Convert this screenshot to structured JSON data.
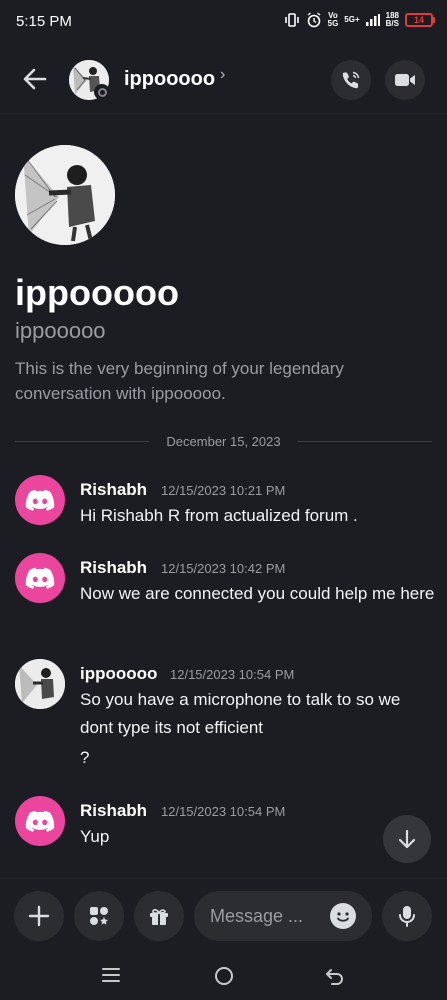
{
  "status_bar": {
    "time": "5:15 PM",
    "network_top": "Vo",
    "network_bottom": "5G",
    "network2_top": "5G+",
    "speed_top": "188",
    "speed_bottom": "B/S",
    "battery": "14"
  },
  "header": {
    "name": "ippooooo",
    "chevron": "›",
    "status": "offline"
  },
  "profile": {
    "display_name": "ippooooo",
    "username": "ippooooo",
    "intro": "This is the very beginning of your legendary conversation with ippooooo."
  },
  "date_divider": "December 15, 2023",
  "messages": [
    {
      "author": "Rishabh",
      "time": "12/15/2023 10:21 PM",
      "lines": [
        "Hi Rishabh R from actualized forum ."
      ],
      "avatar": "discord-logo"
    },
    {
      "author": "Rishabh",
      "time": "12/15/2023 10:42 PM",
      "lines": [
        "Now we are connected you could help me here"
      ],
      "avatar": "discord-logo"
    },
    {
      "author": "ippooooo",
      "time": "12/15/2023 10:54 PM",
      "lines": [
        "So you have a microphone to talk to so we dont type its not efficient",
        "?"
      ],
      "avatar": "user-photo"
    },
    {
      "author": "Rishabh",
      "time": "12/15/2023 10:54 PM",
      "lines": [
        "Yup"
      ],
      "avatar": "discord-logo"
    }
  ],
  "composer": {
    "placeholder": "Message ..."
  },
  "colors": {
    "background": "#1c1d22",
    "discord_pink": "#eb459e",
    "battery_low": "#e03a3a"
  }
}
